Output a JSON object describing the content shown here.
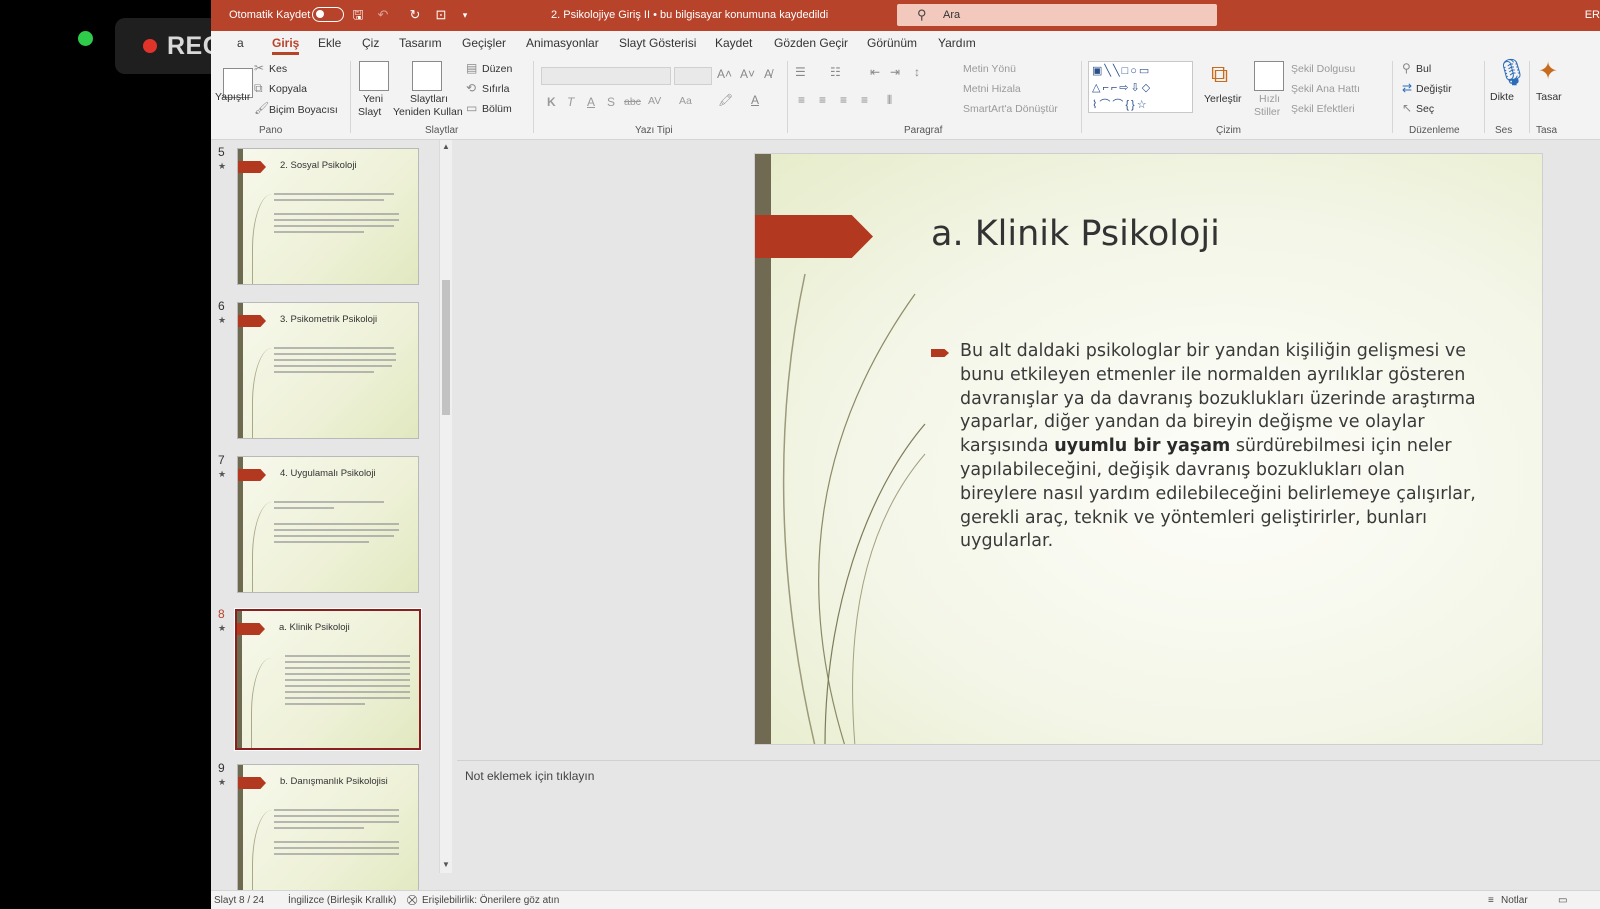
{
  "recording": {
    "label": "REC"
  },
  "titlebar": {
    "autosave_label": "Otomatik Kaydet",
    "document_title": "2. Psikolojiye Giriş II  •  bu bilgisayar konumuna kaydedildi",
    "search_placeholder": "Ara",
    "user_initials": "ER"
  },
  "tabs": [
    "a",
    "Giriş",
    "Ekle",
    "Çiz",
    "Tasarım",
    "Geçişler",
    "Animasyonlar",
    "Slayt Gösterisi",
    "Kaydet",
    "Gözden Geçir",
    "Görünüm",
    "Yardım"
  ],
  "ribbon": {
    "pano": {
      "paste": "Yapıştır",
      "cut": "Kes",
      "copy": "Kopyala",
      "format_painter": "Biçim Boyacısı",
      "group": "Pano"
    },
    "slaytlar": {
      "new_slide_1": "Yeni",
      "new_slide_2": "Slayt",
      "reuse_1": "Slaytları",
      "reuse_2": "Yeniden Kullan",
      "layout": "Düzen",
      "reset": "Sıfırla",
      "section": "Bölüm",
      "group": "Slaytlar"
    },
    "yazi": {
      "bold": "K",
      "italic": "T",
      "underline": "A",
      "shadow": "S",
      "strike": "abc",
      "spacing": "AV",
      "case": "Aa",
      "group": "Yazı Tipi"
    },
    "paragraf": {
      "text_direction": "Metin Yönü",
      "align_text": "Metni Hizala",
      "smartart": "SmartArt'a Dönüştür",
      "group": "Paragraf"
    },
    "cizim": {
      "arrange": "Yerleştir",
      "quick_1": "Hızlı",
      "quick_2": "Stiller",
      "fill": "Şekil Dolgusu",
      "outline": "Şekil Ana Hattı",
      "effects": "Şekil Efektleri",
      "group": "Çizim"
    },
    "duzenleme": {
      "find": "Bul",
      "replace": "Değiştir",
      "select": "Seç",
      "group": "Düzenleme"
    },
    "ses": {
      "dictate": "Dikte",
      "group": "Ses"
    },
    "tasarim": {
      "label": "Tasar",
      "group": "Tasa"
    }
  },
  "thumbnails": [
    {
      "num": "5",
      "title": "2. Sosyal Psikoloji"
    },
    {
      "num": "6",
      "title": "3. Psikometrik Psikoloji"
    },
    {
      "num": "7",
      "title": "4. Uygulamalı Psikoloji"
    },
    {
      "num": "8",
      "title": "a. Klinik Psikoloji"
    },
    {
      "num": "9",
      "title": "b. Danışmanlık Psikolojisi"
    }
  ],
  "slide": {
    "title": "a. Klinik Psikoloji",
    "body_before": "Bu alt daldaki psikologlar bir yandan kişiliğin gelişmesi ve bunu etkileyen etmenler ile normalden ayrılıklar gösteren davranışlar ya da davranış bozuklukları üzerinde araştırma yaparlar, diğer yandan da bireyin değişme ve olaylar karşısında ",
    "body_bold": "uyumlu bir yaşam",
    "body_after": " sürdürebilmesi için neler yapılabileceğini, değişik davranış bozuklukları olan bireylere nasıl yardım edilebileceğini belirlemeye çalışırlar, gerekli araç, teknik ve yöntemleri geliştirirler, bunları uygularlar."
  },
  "notes": {
    "placeholder": "Not eklemek için tıklayın"
  },
  "status": {
    "slide_count": "Slayt 8 / 24",
    "language": "İngilizce (Birleşik Krallık)",
    "accessibility": "Erişilebilirlik: Önerilere göz atın",
    "notes": "Notlar"
  },
  "colors": {
    "accent": "#b8432b",
    "slide_arrow": "#b2381f",
    "slide_bar": "#6f6a51"
  }
}
